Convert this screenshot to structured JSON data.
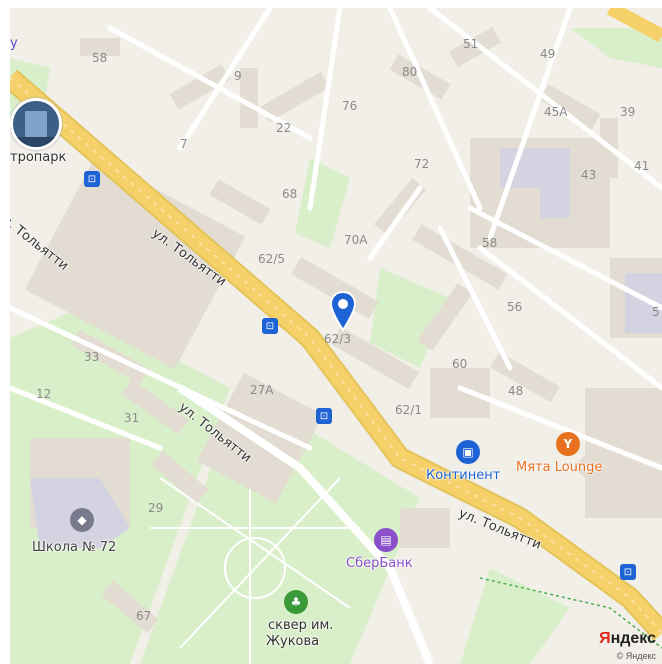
{
  "map": {
    "colors": {
      "background": "#f2efe9",
      "building": "#e2dcd3",
      "green": "#d9efc9",
      "road": "#ffffff",
      "main_road": "#f6d16a",
      "bus_stop": "#1e63d6",
      "marker": "#1e63d6"
    },
    "partial_left_label": "у",
    "streets": [
      "ул. Тольятти",
      "ул. Тольятти",
      "ул. Тольятти",
      "ул. Тольятти"
    ],
    "house_numbers": [
      "58",
      "9",
      "51",
      "80",
      "49",
      "7",
      "22",
      "76",
      "45А",
      "39",
      "72",
      "41",
      "43",
      "68",
      "70А",
      "58",
      "62/5",
      "56",
      "62/3",
      "5",
      "33",
      "60",
      "12",
      "27А",
      "48",
      "31",
      "62/1",
      "29",
      "67"
    ],
    "pois": [
      {
        "name": "Континент",
        "color": "#1e63d6",
        "icon": "shopping-bag-icon"
      },
      {
        "name": "Мята Lounge",
        "color": "#e8701e",
        "icon": "glass-icon"
      },
      {
        "name": "СберБанк",
        "color": "#8a4fc9",
        "icon": "bank-icon"
      },
      {
        "name": "Школа № 72",
        "color": "#7a7a8e",
        "icon": "school-icon"
      },
      {
        "name": "сквер им.",
        "color": "#3a9a3a",
        "icon": "tree-icon"
      },
      {
        "name": "Жукова",
        "color": "#3a9a3a",
        "icon": "tree-icon"
      }
    ],
    "partial_poi": "тропарк",
    "bus_stop_icon": "bus-stop-icon",
    "marker_icon": "location-pin-icon",
    "logo": {
      "part1": "Я",
      "part2": "ндекс"
    },
    "copyright": "© Яндекс"
  }
}
